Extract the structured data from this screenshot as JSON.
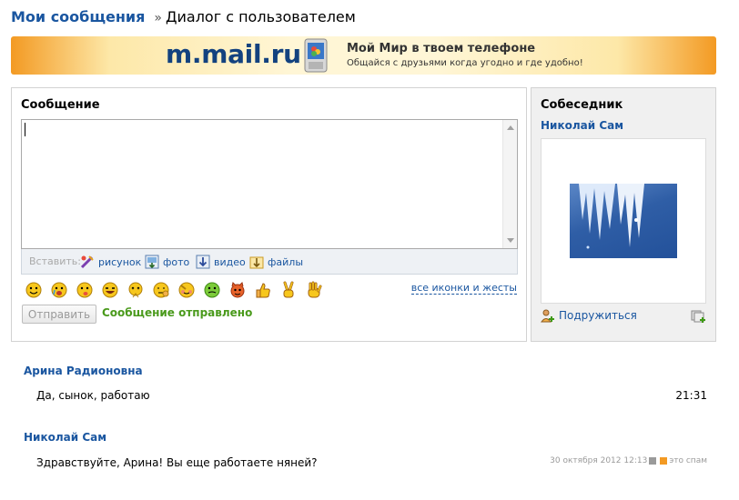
{
  "breadcrumb": {
    "root": "Мои сообщения",
    "separator": "»",
    "current": "Диалог с пользователем"
  },
  "banner": {
    "site": "m.mail.ru",
    "slogan": "Мой Мир в твоем телефоне",
    "subtitle": "Общайся с друзьями когда угодно и где удобно!"
  },
  "compose": {
    "title": "Сообщение",
    "message_value": "",
    "insert_label": "Вставить:",
    "insert_items": [
      "рисунок",
      "фото",
      "видео",
      "файлы"
    ],
    "all_icons_link": "все иконки и жесты",
    "send_label": "Отправить",
    "status": "Сообщение отправлено"
  },
  "smiles": [
    "smile-icon",
    "crying-icon",
    "tongue-icon",
    "laughing-icon",
    "dizzy-icon",
    "pensive-icon",
    "shy-icon",
    "sick-icon",
    "devil-icon",
    "thumbs-up-icon",
    "victory-icon",
    "palm-icon"
  ],
  "interlocutor": {
    "title": "Собеседник",
    "name": "Николай Сам",
    "befriend_label": "Подружиться"
  },
  "messages": [
    {
      "author": "Арина Радионовна",
      "text": "Да, сынок, работаю",
      "time": "21:31"
    },
    {
      "author": "Николай Сам",
      "text": "Здравствуйте, Арина! Вы еще работаете няней?",
      "time": "30 октября 2012 12:13",
      "spam_label": "это спам"
    }
  ],
  "colors": {
    "link": "#1a56a0",
    "status_green": "#4a9a1c",
    "banner_orange": "#f39a23",
    "smiley_yellow": "#f7c71d"
  }
}
